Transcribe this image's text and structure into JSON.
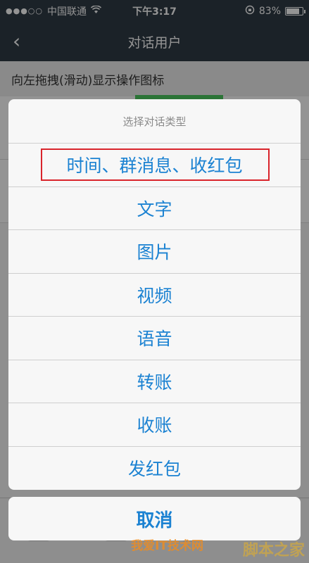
{
  "status_bar": {
    "signal": "●●●○○",
    "carrier": "中国联通",
    "wifi_icon": "wifi-icon",
    "time": "下午3:17",
    "lock_icon": "rotation-lock-icon",
    "battery_text": "83%",
    "battery_level": 0.83
  },
  "nav": {
    "back_icon": "back-chevron-icon",
    "back_glyph": "‹",
    "title": "对话用户"
  },
  "hint": {
    "text": "向左拖拽(滑动)显示操作图标"
  },
  "sheet": {
    "title": "选择对话类型",
    "items": [
      {
        "label": "时间、群消息、收红包",
        "highlighted": true
      },
      {
        "label": "文字"
      },
      {
        "label": "图片"
      },
      {
        "label": "视频"
      },
      {
        "label": "语音"
      },
      {
        "label": "转账"
      },
      {
        "label": "收账"
      },
      {
        "label": "发红包"
      }
    ],
    "cancel_label": "取消"
  },
  "watermark": {
    "site": "脚本之家",
    "tagline": "我爱IT技术网"
  },
  "colors": {
    "nav_bg": "#2f3b46",
    "action_text": "#1b82d2",
    "highlight_border": "#d9242b"
  }
}
